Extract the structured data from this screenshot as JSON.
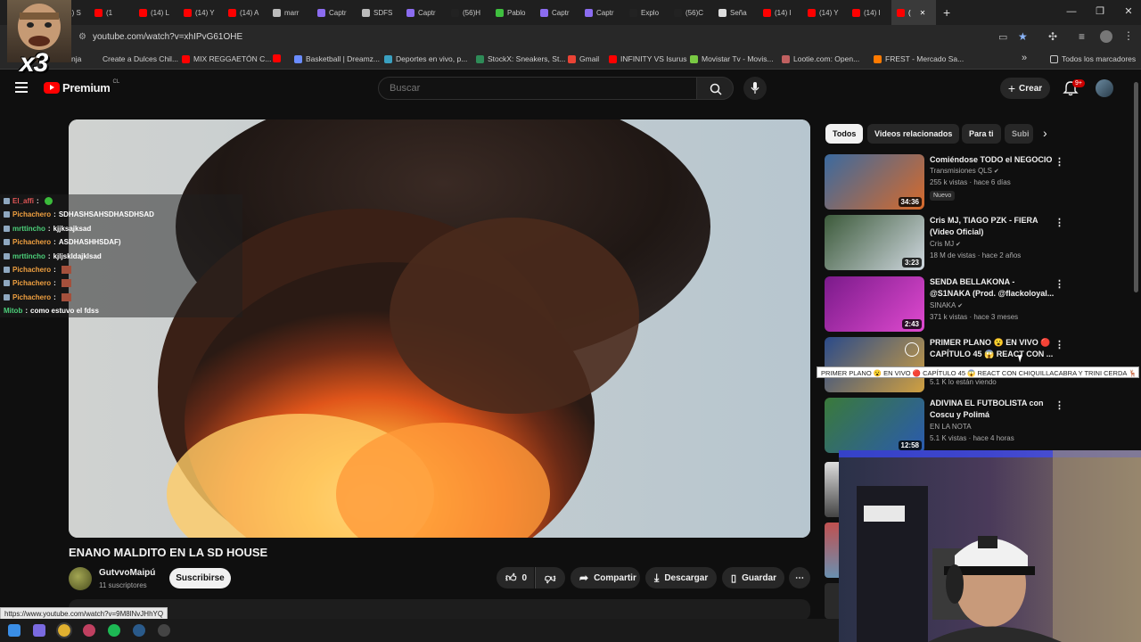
{
  "browser": {
    "tabs": [
      {
        "label": "(14) I",
        "icon": "x-icon",
        "color": "#1f1f1f"
      },
      {
        "label": "(14) S",
        "icon": "x-icon",
        "color": "#1f1f1f"
      },
      {
        "label": "(1",
        "icon": "youtube-icon",
        "color": "#ff0000"
      },
      {
        "label": "(14) L",
        "icon": "youtube-icon",
        "color": "#ff0000"
      },
      {
        "label": "(14) Y",
        "icon": "youtube-icon",
        "color": "#ff0000"
      },
      {
        "label": "(14) A",
        "icon": "youtube-icon",
        "color": "#ff0000"
      },
      {
        "label": "marr",
        "icon": "chatgpt-icon",
        "color": "#bbbbbb"
      },
      {
        "label": "Captr",
        "icon": "pen-icon",
        "color": "#8b6cf0"
      },
      {
        "label": "SDFS",
        "icon": "chatgpt-icon",
        "color": "#bbbbbb"
      },
      {
        "label": "Captr",
        "icon": "pen-icon",
        "color": "#8b6cf0"
      },
      {
        "label": "(56)H",
        "icon": "tiktok-icon",
        "color": "#222222"
      },
      {
        "label": "Pablo",
        "icon": "p-icon",
        "color": "#3fbf3f"
      },
      {
        "label": "Captr",
        "icon": "pen-icon",
        "color": "#8b6cf0"
      },
      {
        "label": "Captr",
        "icon": "pen-icon",
        "color": "#8b6cf0"
      },
      {
        "label": "Explo",
        "icon": "tiktok-icon",
        "color": "#222222"
      },
      {
        "label": "(56)C",
        "icon": "tiktok-icon",
        "color": "#222222"
      },
      {
        "label": "Seña",
        "icon": "g-icon",
        "color": "#dddddd"
      },
      {
        "label": "(14) I",
        "icon": "youtube-icon",
        "color": "#ff0000"
      },
      {
        "label": "(14) Y",
        "icon": "youtube-icon",
        "color": "#ff0000"
      },
      {
        "label": "(14) I",
        "icon": "youtube-icon",
        "color": "#ff0000"
      },
      {
        "label": "(",
        "icon": "youtube-icon",
        "color": "#ff0000",
        "active": true
      }
    ],
    "new_tab": "+",
    "window_controls": {
      "minimize": "—",
      "restore": "❐",
      "close": "✕"
    },
    "url": "youtube.com/watch?v=xhIPvG61OHE",
    "bookmarks": [
      {
        "label": "nja",
        "color": "#282828"
      },
      {
        "label": "Create a Dulces Chil...",
        "color": "#282828"
      },
      {
        "label": "MIX REGGAETÓN C...",
        "color": "#ff0000"
      },
      {
        "label": "",
        "color": "#ff0000"
      },
      {
        "label": "Basketball | Dreamz...",
        "color": "#6a8cff"
      },
      {
        "label": "Deportes en vivo, p...",
        "color": "#3aa0c0"
      },
      {
        "label": "StockX: Sneakers, St...",
        "color": "#2e8b57"
      },
      {
        "label": "Gmail",
        "color": "#ea4335"
      },
      {
        "label": "INFINITY VS Isurus",
        "color": "#ff0000"
      },
      {
        "label": "Movistar Tv - Movis...",
        "color": "#79c943"
      },
      {
        "label": "Lootie.com: Open...",
        "color": "#c06060"
      },
      {
        "label": "FREST - Mercado Sa...",
        "color": "#ff7a00"
      }
    ],
    "bookmarks_more": "»",
    "all_bookmarks": "Todos los marcadores"
  },
  "overlay": {
    "multiplier": "x3"
  },
  "youtube": {
    "logo_text": "Premium",
    "logo_region": "CL",
    "search_placeholder": "Buscar",
    "create_label": "Crear",
    "notifications": "9+"
  },
  "chat": [
    {
      "user": "El_affi",
      "color": "#e05555",
      "msg": "",
      "emote": "green"
    },
    {
      "user": "Pichachero",
      "color": "#f0a040",
      "msg": "SDHASHSAHSDHASDHSAD",
      "emote": ""
    },
    {
      "user": "mrttincho",
      "color": "#4cd07a",
      "msg": "kjjksajksad",
      "emote": ""
    },
    {
      "user": "Pichachero",
      "color": "#f0a040",
      "msg": "ASDHASHHSDAF)",
      "emote": ""
    },
    {
      "user": "mrttincho",
      "color": "#4cd07a",
      "msg": "kjljskldajklsad",
      "emote": ""
    },
    {
      "user": "Pichachero",
      "color": "#f0a040",
      "msg": "",
      "emote": "face"
    },
    {
      "user": "Pichachero",
      "color": "#f0a040",
      "msg": "",
      "emote": "face"
    },
    {
      "user": "Pichachero",
      "color": "#f0a040",
      "msg": "",
      "emote": "face"
    },
    {
      "user": "Mitob",
      "color": "#4cd07a",
      "msg": "como estuvo el fdss",
      "emote": ""
    }
  ],
  "video": {
    "title": "ENANO MALDITO EN LA SD HOUSE",
    "channel": "GutvvoMaipú",
    "subscribers": "11 suscriptores",
    "subscribe_label": "Suscribirse",
    "likes": "0",
    "share_label": "Compartir",
    "download_label": "Descargar",
    "save_label": "Guardar"
  },
  "chips": [
    {
      "label": "Todos",
      "active": true
    },
    {
      "label": "Videos relacionados",
      "active": false
    },
    {
      "label": "Para ti",
      "active": false
    },
    {
      "label": "Subi",
      "active": false
    }
  ],
  "recommendations": [
    {
      "title": "Comiéndose TODO el NEGOCIO",
      "channel": "Transmisiones QLS",
      "verified": true,
      "meta": "255 k vistas · hace 6 días",
      "badge": "Nuevo",
      "duration": "34:36",
      "thumb_colors": [
        "#3a6aa0",
        "#d86a2a"
      ]
    },
    {
      "title": "Cris MJ, TIAGO PZK - FIERA (Video Oficial)",
      "channel": "Cris MJ",
      "verified": true,
      "meta": "18 M de vistas · hace 2 años",
      "badge": "",
      "duration": "3:23",
      "thumb_colors": [
        "#3c5a3a",
        "#d0d8e0"
      ]
    },
    {
      "title": "SENDA BELLAKONA - @S1NAKA (Prod. @flackoloyal...",
      "channel": "SINAKA",
      "verified": true,
      "meta": "371 k vistas · hace 3 meses",
      "badge": "",
      "duration": "2:43",
      "thumb_colors": [
        "#7a1a8a",
        "#e04ad0"
      ]
    },
    {
      "title": "PRIMER PLANO 😮 EN VIVO 🔴 CAPÍTULO 45 😱 REACT CON ...",
      "channel": "",
      "verified": false,
      "meta": "5.1 K lo están viendo",
      "badge": "",
      "duration": "",
      "thumb_colors": [
        "#2a4a8a",
        "#d0a040"
      ]
    },
    {
      "title": "ADIVINA EL FUTBOLISTA con Coscu y Polimá",
      "channel": "EN LA NOTA",
      "verified": false,
      "meta": "5.1 K vistas · hace 4 horas",
      "badge": "",
      "duration": "12:58",
      "thumb_colors": [
        "#3a7a3a",
        "#2a5ab0"
      ]
    }
  ],
  "tooltip": "PRIMER PLANO 😮 EN VIVO 🔴 CAPÍTULO 45 😱 REACT CON CHIQUILLACABRA Y TRINI CERDA 🦌",
  "status_url": "https://www.youtube.com/watch?v=9M8lNvJHhYQ",
  "taskbar": [
    {
      "name": "windows-start-icon",
      "color": "#3a8ee6"
    },
    {
      "name": "copilot-icon",
      "color": "#7a6ae0"
    },
    {
      "name": "chrome-icon",
      "color": "#e0b030"
    },
    {
      "name": "opera-icon",
      "color": "#c04060"
    },
    {
      "name": "spotify-icon",
      "color": "#1db954"
    },
    {
      "name": "steam-icon",
      "color": "#2a5a8a"
    },
    {
      "name": "obs-icon",
      "color": "#444444"
    }
  ]
}
